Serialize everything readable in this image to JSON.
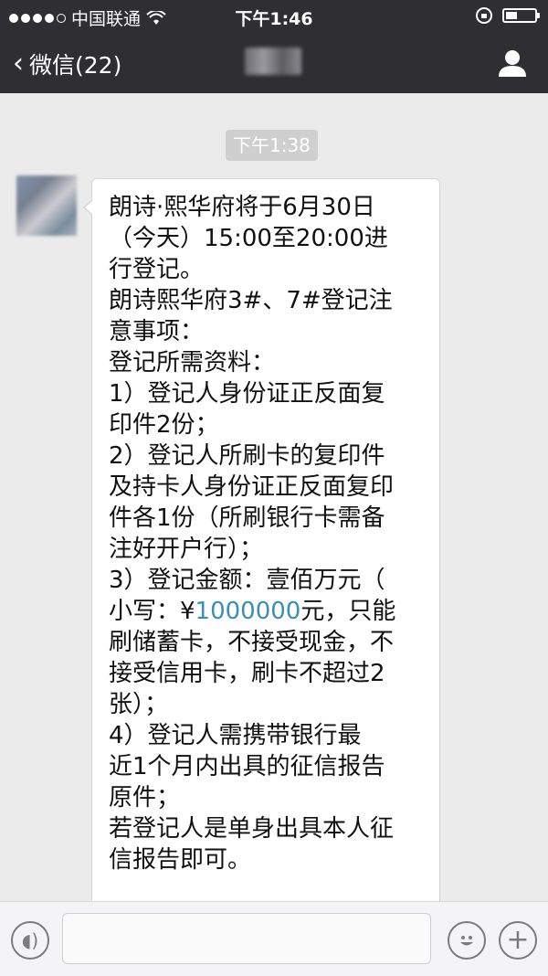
{
  "status_bar": {
    "carrier": "中国联通",
    "time": "下午1:46"
  },
  "nav": {
    "back_label": "微信(22)"
  },
  "chat": {
    "timestamp": "下午1:38",
    "message_lines": [
      "朗诗·熙华府将于6月30日",
      "（今天）15:00至20:00进",
      "行登记。",
      "朗诗熙华府3#、7#登记注",
      "意事项：",
      "登记所需资料：",
      " 1）登记人身份证正反面复",
      "印件2份；",
      " 2）登记人所刷卡的复印件",
      "及持卡人身份证正反面复印",
      "件各1份（所刷银行卡需备",
      "注好开户行）；",
      " 3）登记金额：壹佰万元（",
      "小写：¥",
      "1000000",
      "元，只能",
      "刷储蓄卡，不接受现金，不",
      "接受信用卡，刷卡不超过2",
      "张）；",
      "  4）登记人需携带银行最",
      "近1个月内出具的征信报告",
      "原件；",
      "若登记人是单身出具本人征",
      "信报告即可。"
    ]
  },
  "colors": {
    "header": "#2e2e33",
    "chat_bg": "#ebebeb",
    "link": "#3a8fb7"
  }
}
